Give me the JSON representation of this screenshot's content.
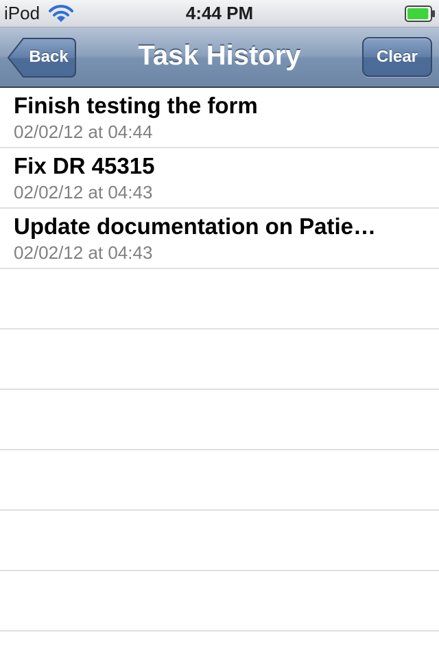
{
  "status_bar": {
    "carrier": "iPod",
    "time": "4:44 PM",
    "wifi_icon": "wifi-icon",
    "battery_icon": "battery-icon",
    "battery_fill_fraction": 0.95,
    "battery_color": "#3cd53c"
  },
  "nav_bar": {
    "title": "Task History",
    "back_label": "Back",
    "clear_label": "Clear",
    "tint_color": "#6d86a6"
  },
  "tasks": [
    {
      "title": "Finish testing the form",
      "timestamp": "02/02/12 at 04:44"
    },
    {
      "title": "Fix DR 45315",
      "timestamp": "02/02/12 at 04:43"
    },
    {
      "title": "Update documentation on Patie…",
      "timestamp": "02/02/12 at 04:43"
    }
  ],
  "colors": {
    "title_text": "#000000",
    "subtitle_text": "#808080",
    "separator": "#e0e0e0"
  }
}
